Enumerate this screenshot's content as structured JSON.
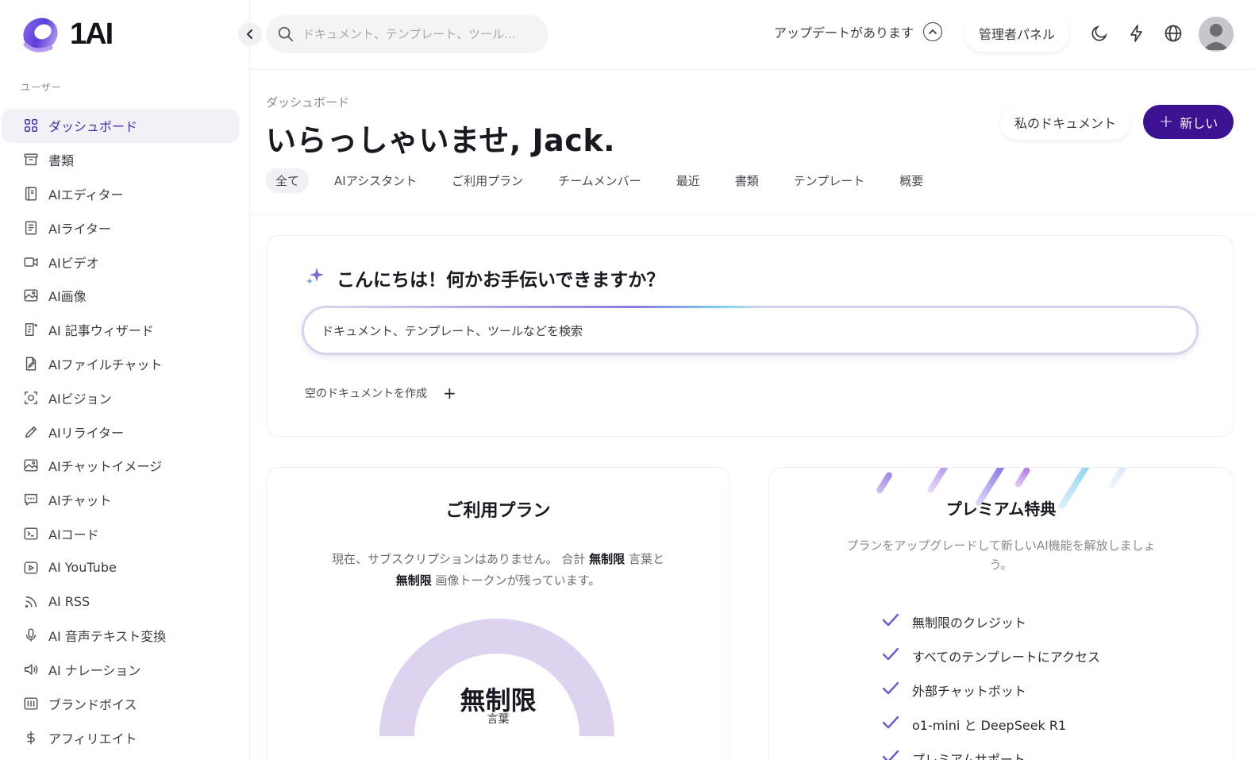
{
  "brand": {
    "name": "1AI"
  },
  "sidebar": {
    "section_label": "ユーザー",
    "items": [
      {
        "label": "ダッシュボード",
        "icon": "grid-icon",
        "active": true
      },
      {
        "label": "書類",
        "icon": "archive-icon"
      },
      {
        "label": "AIエディター",
        "icon": "book-icon"
      },
      {
        "label": "AIライター",
        "icon": "document-icon"
      },
      {
        "label": "AIビデオ",
        "icon": "video-icon"
      },
      {
        "label": "AI画像",
        "icon": "image-icon"
      },
      {
        "label": "AI 記事ウィザード",
        "icon": "article-icon"
      },
      {
        "label": "AIファイルチャット",
        "icon": "file-edit-icon"
      },
      {
        "label": "AIビジョン",
        "icon": "scan-icon"
      },
      {
        "label": "AIリライター",
        "icon": "pen-icon"
      },
      {
        "label": "AIチャットイメージ",
        "icon": "image-icon"
      },
      {
        "label": "AIチャット",
        "icon": "chat-icon"
      },
      {
        "label": "AIコード",
        "icon": "terminal-icon"
      },
      {
        "label": "AI YouTube",
        "icon": "play-icon"
      },
      {
        "label": "AI RSS",
        "icon": "rss-icon"
      },
      {
        "label": "AI 音声テキスト変換",
        "icon": "microphone-icon"
      },
      {
        "label": "AI ナレーション",
        "icon": "speaker-icon"
      },
      {
        "label": "ブランドボイス",
        "icon": "brand-icon"
      },
      {
        "label": "アフィリエイト",
        "icon": "dollar-icon"
      }
    ]
  },
  "topbar": {
    "search_placeholder": "ドキュメント、テンプレート、ツール...",
    "update_label": "アップデートがあります",
    "admin_label": "管理者パネル"
  },
  "main": {
    "breadcrumb": "ダッシュボード",
    "welcome": "いらっしゃいませ, Jack.",
    "my_documents": "私のドキュメント",
    "new_label": "新しい",
    "tabs": [
      "全て",
      "AIアシスタント",
      "ご利用プラン",
      "チームメンバー",
      "最近",
      "書類",
      "テンプレート",
      "概要"
    ],
    "active_tab": 0
  },
  "assistant": {
    "title": "こんにちは！何かお手伝いできますか？",
    "search_placeholder": "ドキュメント、テンプレート、ツールなどを検索",
    "create_doc": "空のドキュメントを作成"
  },
  "plan": {
    "title": "ご利用プラン",
    "desc_1": "現在、サブスクリプションはありません。 合計",
    "word_amount": "無制限",
    "desc_2": "言葉と",
    "image_amount": "無制限",
    "desc_3": "画像トークンが残っています。",
    "gauge_value": "無制限",
    "gauge_unit": "言葉",
    "gauge_fill": 1.0
  },
  "premium": {
    "title": "プレミアム特典",
    "desc": "プランをアップグレードして新しいAI機能を解放しましょう。",
    "features": [
      "無制限のクレジット",
      "すべてのテンプレートにアクセス",
      "外部チャットボット",
      "o1-mini と DeepSeek R1",
      "プレミアムサポート"
    ]
  },
  "colors": {
    "accent": "#3c1292",
    "active_nav": "#4a2ba7",
    "gauge": "#ddd3f1",
    "check": "#6a5bd0"
  }
}
